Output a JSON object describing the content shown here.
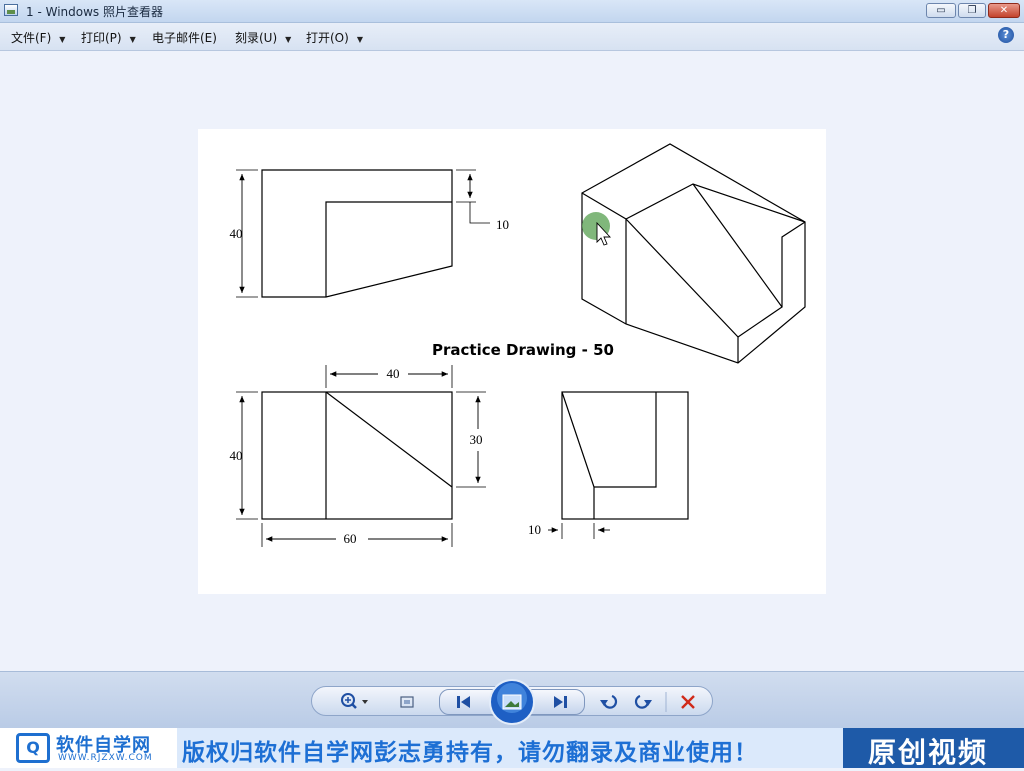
{
  "window": {
    "title": "1 - Windows 照片查看器",
    "min_glyph": "▭",
    "max_glyph": "❐",
    "close_glyph": "✕"
  },
  "menu": {
    "items": [
      {
        "label": "文件(F)",
        "has_arrow": true
      },
      {
        "label": "打印(P)",
        "has_arrow": true
      },
      {
        "label": "电子邮件(E)",
        "has_arrow": false
      },
      {
        "label": "刻录(U)",
        "has_arrow": true
      },
      {
        "label": "打开(O)",
        "has_arrow": true
      }
    ],
    "help": "?"
  },
  "drawing": {
    "title": "Practice Drawing - 50",
    "dims": {
      "front_height": "40",
      "step": "10",
      "top_width": "40",
      "top_height": "40",
      "top_depth": "30",
      "overall_width": "60",
      "side_offset": "10"
    }
  },
  "toolbar": {
    "zoom_icon": "zoom-icon",
    "fit_icon": "actual-size-icon",
    "prev_icon": "previous-icon",
    "slideshow_icon": "slideshow-icon",
    "next_icon": "next-icon",
    "rotate_ccw_icon": "rotate-left-icon",
    "rotate_cw_icon": "rotate-right-icon",
    "delete_icon": "delete-icon"
  },
  "banner": {
    "logo_mark": "Q",
    "logo_text": "软件自学网",
    "logo_url": "WWW.RJZXW.COM",
    "slogan": "版权归软件自学网彭志勇持有，请勿翻录及商业使用！",
    "original": "原创视频"
  },
  "colors": {
    "accent": "#1e6fd0",
    "close_red": "#c3432c",
    "cursor_highlight": "#6aaa64"
  }
}
